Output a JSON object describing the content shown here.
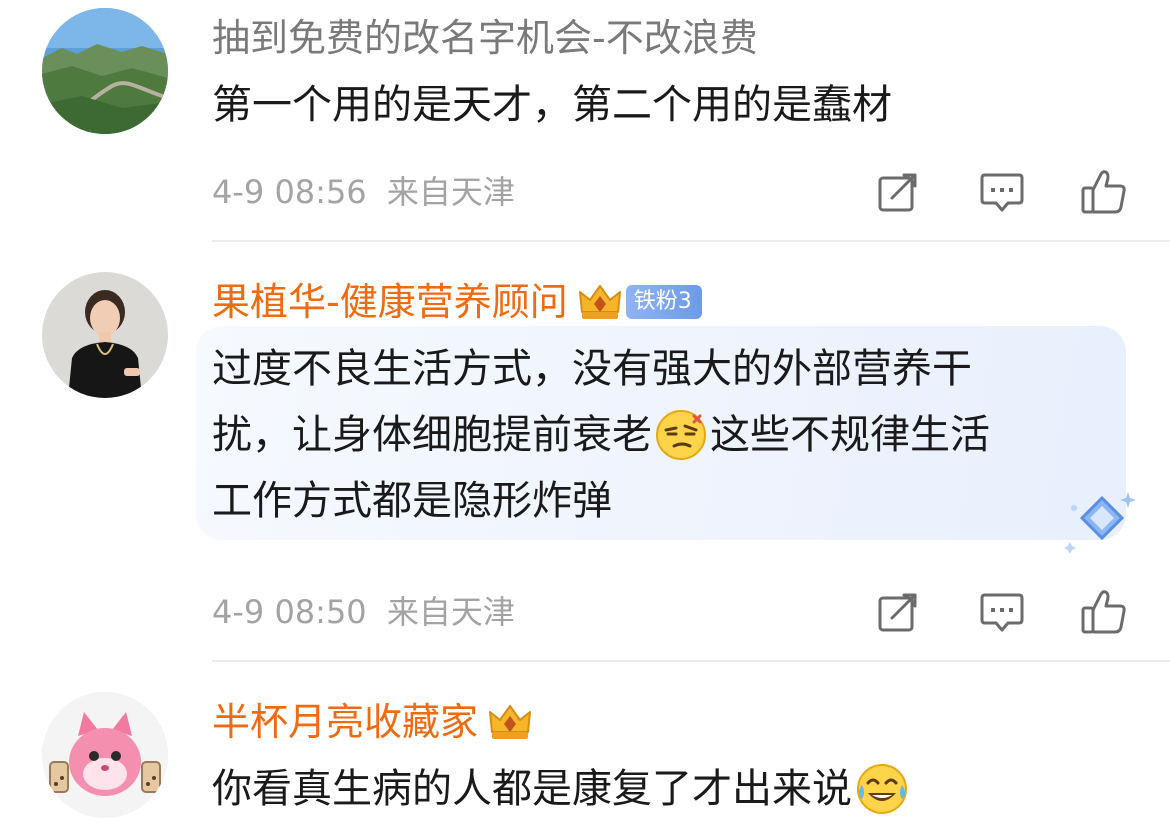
{
  "comments": [
    {
      "username": "抽到免费的改名字机会-不改浪费",
      "text_lines": [
        "第一个用的是天才，第二个用的是蠢材"
      ],
      "timestamp": "4-9 08:56",
      "location": "来自天津",
      "avatar": "mountain-landscape"
    },
    {
      "username": "果植华-健康营养顾问",
      "fan_badge": "铁粉3",
      "text_lines": [
        "过度不良生活方式，没有强大的外部营养干",
        "扰，让身体细胞提前衰老",
        "这些不规律生活",
        "工作方式都是隐形炸弹"
      ],
      "timestamp": "4-9 08:50",
      "location": "来自天津",
      "avatar": "woman-portrait"
    },
    {
      "username": "半杯月亮收藏家",
      "text_lines": [
        "你看真生病的人都是康复了才出来说"
      ],
      "avatar": "pink-cartoon"
    }
  ],
  "icons": {
    "forward": "share-edit-icon",
    "comment": "comment-bubble-icon",
    "like": "thumbs-up-icon",
    "crown": "crown-badge-icon",
    "emoji_smirk": "smirk-emoji-icon",
    "emoji_laugh": "tears-of-joy-emoji-icon"
  },
  "colors": {
    "vip_name": "#f06a10",
    "plain_name": "#7a7a7a",
    "meta": "#a3a3a3",
    "icon_stroke": "#6b6b6b",
    "fan_badge": "#7aa5ee"
  }
}
